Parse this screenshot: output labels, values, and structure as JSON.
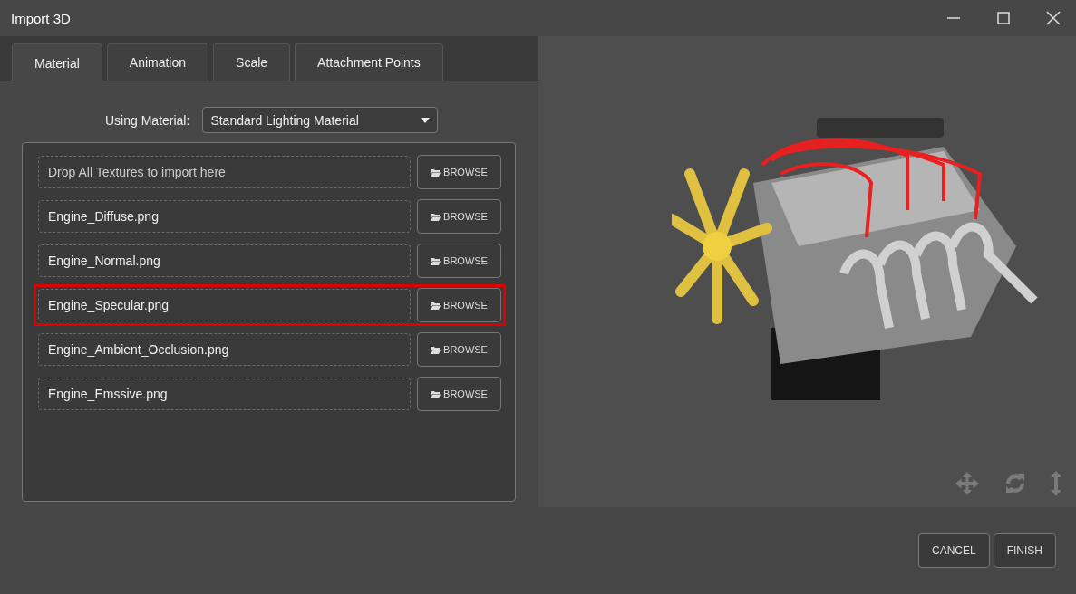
{
  "window": {
    "title": "Import 3D"
  },
  "tabs": [
    {
      "label": "Material",
      "selected": true
    },
    {
      "label": "Animation",
      "selected": false
    },
    {
      "label": "Scale",
      "selected": false
    },
    {
      "label": "Attachment Points",
      "selected": false
    }
  ],
  "material": {
    "label": "Using Material:",
    "value": "Standard Lighting Material"
  },
  "textures": [
    {
      "placeholder": "Drop All Textures to import here",
      "button": "BROWSE",
      "highlighted": false
    },
    {
      "value": "Engine_Diffuse.png",
      "button": "BROWSE",
      "highlighted": false
    },
    {
      "value": "Engine_Normal.png",
      "button": "BROWSE",
      "highlighted": false
    },
    {
      "value": "Engine_Specular.png",
      "button": "BROWSE",
      "highlighted": true
    },
    {
      "value": "Engine_Ambient_Occlusion.png",
      "button": "BROWSE",
      "highlighted": false
    },
    {
      "value": "Engine_Emssive.png",
      "button": "BROWSE",
      "highlighted": false
    }
  ],
  "buttons": [
    "CANCEL",
    "FINISH"
  ]
}
